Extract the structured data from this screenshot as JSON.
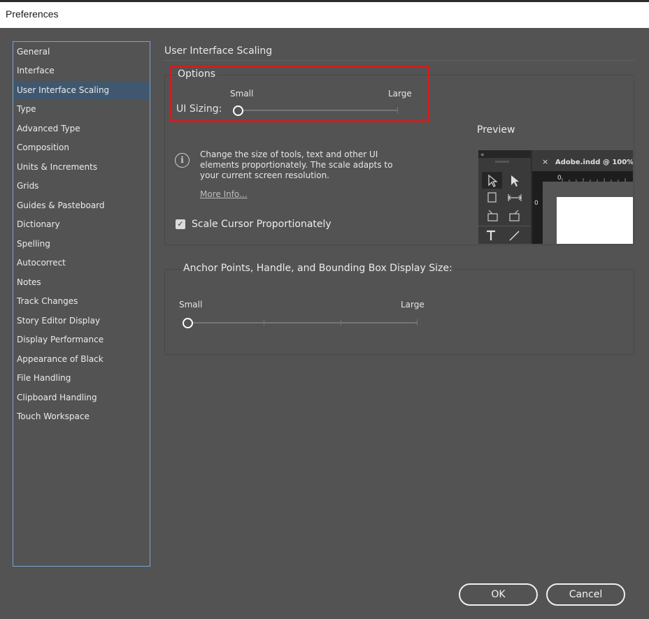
{
  "window": {
    "title": "Preferences"
  },
  "sidebar": {
    "items": [
      {
        "label": "General",
        "selected": false
      },
      {
        "label": "Interface",
        "selected": false
      },
      {
        "label": "User Interface Scaling",
        "selected": true
      },
      {
        "label": "Type",
        "selected": false
      },
      {
        "label": "Advanced Type",
        "selected": false
      },
      {
        "label": "Composition",
        "selected": false
      },
      {
        "label": "Units & Increments",
        "selected": false
      },
      {
        "label": "Grids",
        "selected": false
      },
      {
        "label": "Guides & Pasteboard",
        "selected": false
      },
      {
        "label": "Dictionary",
        "selected": false
      },
      {
        "label": "Spelling",
        "selected": false
      },
      {
        "label": "Autocorrect",
        "selected": false
      },
      {
        "label": "Notes",
        "selected": false
      },
      {
        "label": "Track Changes",
        "selected": false
      },
      {
        "label": "Story Editor Display",
        "selected": false
      },
      {
        "label": "Display Performance",
        "selected": false
      },
      {
        "label": "Appearance of Black",
        "selected": false
      },
      {
        "label": "File Handling",
        "selected": false
      },
      {
        "label": "Clipboard Handling",
        "selected": false
      },
      {
        "label": "Touch Workspace",
        "selected": false
      }
    ]
  },
  "main": {
    "section_title": "User Interface Scaling",
    "options": {
      "legend": "Options",
      "ui_sizing_label": "UI Sizing:",
      "small_label": "Small",
      "large_label": "Large",
      "ui_sizing_level": 0,
      "description": "Change the size of tools, text and other UI elements proportionately. The scale adapts to your current screen resolution.",
      "more_info": "More Info...",
      "scale_cursor_label": "Scale Cursor Proportionately",
      "scale_cursor_checked": true,
      "checkmark": "✓",
      "info_glyph": "i",
      "preview_label": "Preview",
      "preview": {
        "collapse_glyph": "«",
        "tab_close": "×",
        "tab_title": "Adobe.indd @ 100% |",
        "ruler_zero_h": "0",
        "ruler_zero_v": "0"
      }
    },
    "anchor": {
      "legend": "Anchor Points, Handle, and Bounding Box Display Size:",
      "small_label": "Small",
      "large_label": "Large",
      "level": 0
    }
  },
  "footer": {
    "ok_label": "OK",
    "cancel_label": "Cancel"
  },
  "colors": {
    "background": "#535353",
    "selected_item": "#3f5870",
    "sidebar_border": "#7aa3cf",
    "highlight": "#d31d1d"
  }
}
